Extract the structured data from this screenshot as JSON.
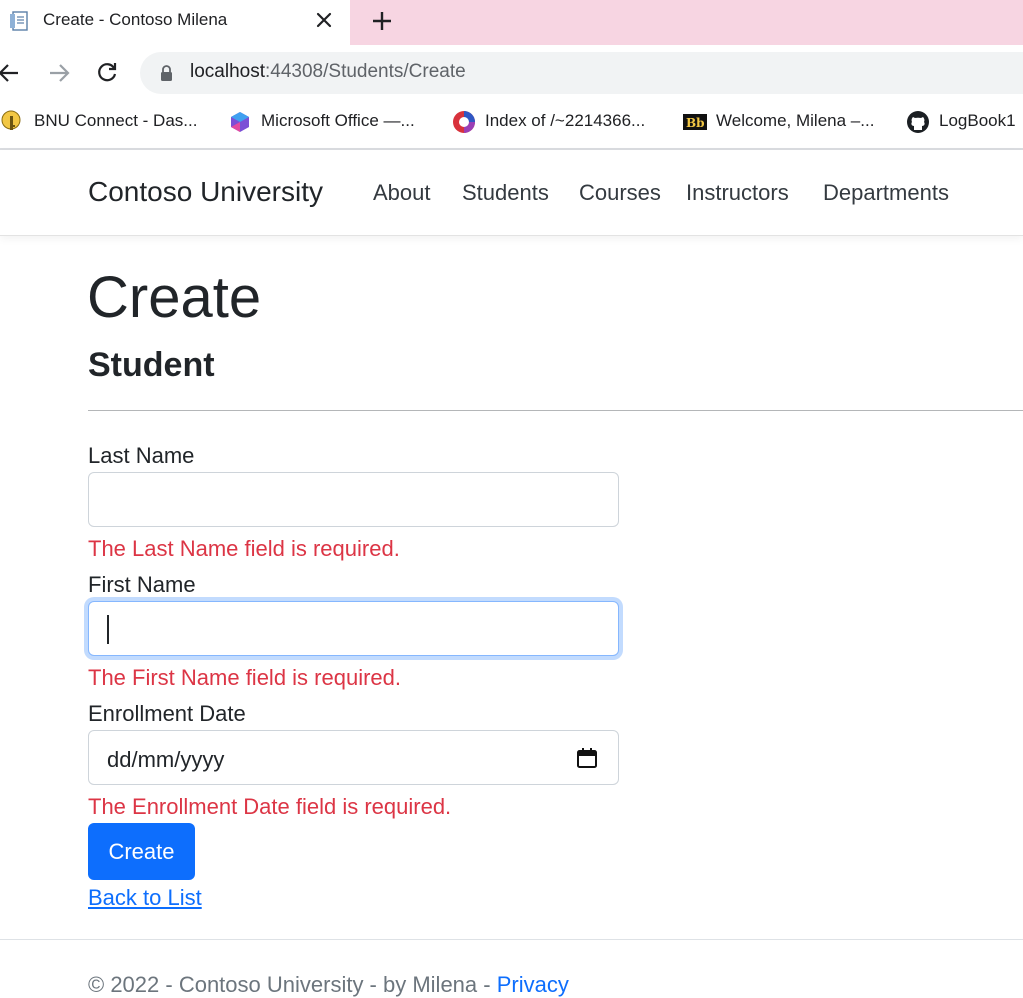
{
  "browser": {
    "tab_title": "Create - Contoso Milena",
    "url_host": "localhost",
    "url_rest": ":44308/Students/Create",
    "bookmarks": [
      {
        "label": "BNU Connect - Das...",
        "icon": "key-icon"
      },
      {
        "label": "Microsoft Office —...",
        "icon": "office-icon"
      },
      {
        "label": "Index of /~2214366...",
        "icon": "index-icon"
      },
      {
        "label": "Welcome, Milena –...",
        "icon": "blackboard-icon"
      },
      {
        "label": "LogBook1",
        "icon": "github-icon"
      }
    ],
    "colors": {
      "tabstrip": "#f7d5e2",
      "omnibox": "#f1f3f4"
    }
  },
  "site": {
    "brand": "Contoso University",
    "nav": [
      "About",
      "Students",
      "Courses",
      "Instructors",
      "Departments"
    ]
  },
  "page": {
    "title": "Create",
    "subtitle": "Student",
    "fields": [
      {
        "label": "Last Name",
        "value": "",
        "error": "The Last Name field is required."
      },
      {
        "label": "First Name",
        "value": "",
        "error": "The First Name field is required."
      },
      {
        "label": "Enrollment Date",
        "value": "dd/mm/yyyy",
        "error": "The Enrollment Date field is required."
      }
    ],
    "submit_label": "Create",
    "back_link": "Back to List",
    "colors": {
      "error": "#dc3545",
      "primary": "#0d6efd"
    }
  },
  "footer": {
    "text": "© 2022 - Contoso University - by Milena - ",
    "privacy": "Privacy"
  }
}
